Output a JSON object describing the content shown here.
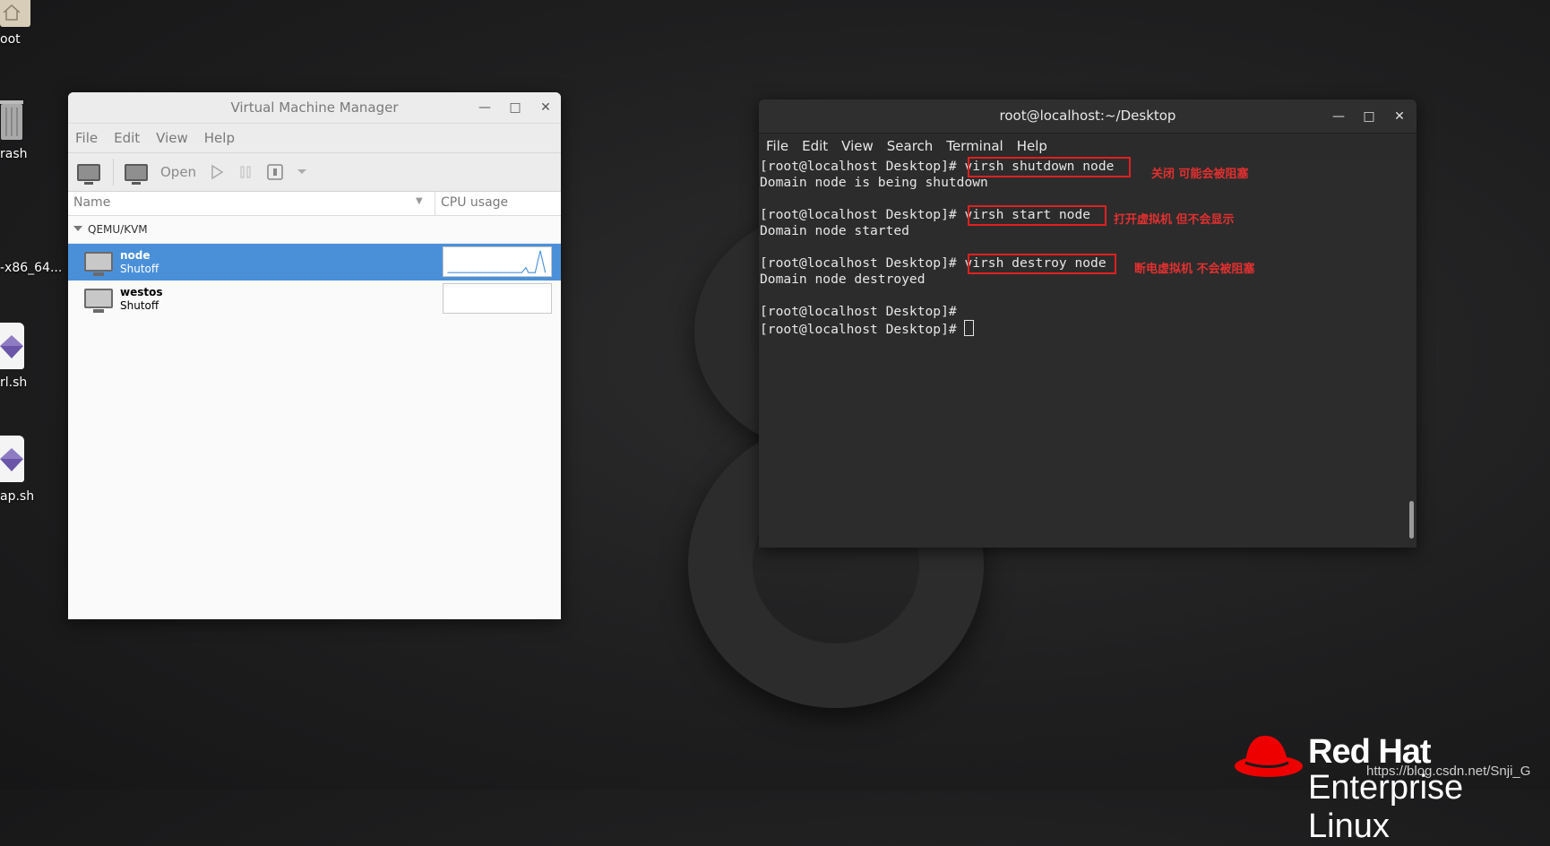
{
  "desktop": {
    "icons": [
      {
        "label": "oot"
      },
      {
        "label": "rash"
      },
      {
        "label": "-x86_64..."
      },
      {
        "label": "rl.sh"
      },
      {
        "label": "ap.sh"
      }
    ]
  },
  "vmm": {
    "title": "Virtual Machine Manager",
    "menu": [
      "File",
      "Edit",
      "View",
      "Help"
    ],
    "toolbar": {
      "open_label": "Open"
    },
    "columns": {
      "name": "Name",
      "cpu": "CPU usage"
    },
    "group": "QEMU/KVM",
    "vms": [
      {
        "name": "node",
        "state": "Shutoff",
        "selected": true
      },
      {
        "name": "westos",
        "state": "Shutoff",
        "selected": false
      }
    ]
  },
  "terminal": {
    "title": "root@localhost:~/Desktop",
    "menu": [
      "File",
      "Edit",
      "View",
      "Search",
      "Terminal",
      "Help"
    ],
    "prompt": "[root@localhost Desktop]# ",
    "lines": [
      {
        "cmd": "virsh shutdown node",
        "out": "Domain node is being shutdown",
        "note": "关闭 可能会被阻塞"
      },
      {
        "cmd": "virsh start node",
        "out": "Domain node started",
        "note": "打开虚拟机 但不会显示"
      },
      {
        "cmd": "virsh destroy node",
        "out": "Domain node destroyed",
        "note": "断电虚拟机  不会被阻塞"
      }
    ]
  },
  "branding": {
    "logo_text": "Red Hat",
    "logo_sub": "Enterprise Linux",
    "watermark": "https://blog.csdn.net/Snji_G",
    "logo_color": "#ee0000"
  }
}
